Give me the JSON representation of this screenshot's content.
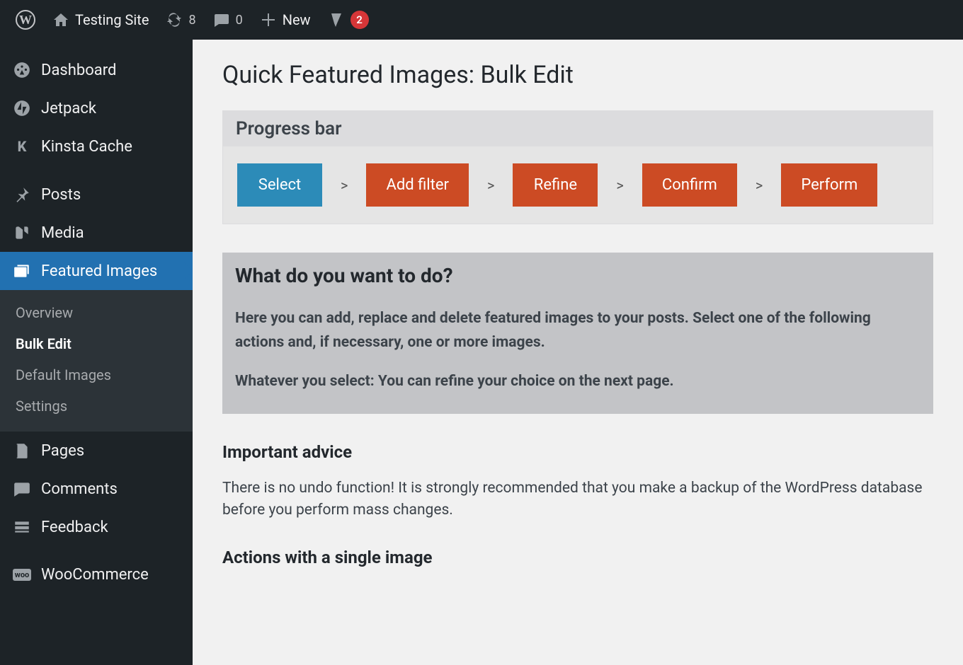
{
  "adminbar": {
    "site_name": "Testing Site",
    "updates_count": "8",
    "comments_count": "0",
    "new_label": "New",
    "yoast_count": "2"
  },
  "sidebar": {
    "items": [
      {
        "label": "Dashboard",
        "icon": "dashboard"
      },
      {
        "label": "Jetpack",
        "icon": "jetpack"
      },
      {
        "label": "Kinsta Cache",
        "icon": "kinsta"
      },
      {
        "label": "Posts",
        "icon": "posts"
      },
      {
        "label": "Media",
        "icon": "media"
      },
      {
        "label": "Featured Images",
        "icon": "featured",
        "active": true
      },
      {
        "label": "Pages",
        "icon": "pages"
      },
      {
        "label": "Comments",
        "icon": "comments"
      },
      {
        "label": "Feedback",
        "icon": "feedback"
      },
      {
        "label": "WooCommerce",
        "icon": "woo"
      }
    ],
    "submenu": [
      {
        "label": "Overview"
      },
      {
        "label": "Bulk Edit",
        "current": true
      },
      {
        "label": "Default Images"
      },
      {
        "label": "Settings"
      }
    ]
  },
  "main": {
    "title": "Quick Featured Images: Bulk Edit",
    "progress": {
      "header": "Progress bar",
      "steps": [
        "Select",
        "Add filter",
        "Refine",
        "Confirm",
        "Perform"
      ],
      "current_index": 0,
      "separator": ">"
    },
    "infobox": {
      "heading": "What do you want to do?",
      "p1": "Here you can add, replace and delete featured images to your posts. Select one of the following actions and, if necessary, one or more images.",
      "p2": "Whatever you select: You can refine your choice on the next page."
    },
    "advice": {
      "heading": "Important advice",
      "text": "There is no undo function! It is strongly recommended that you make a backup of the WordPress database before you perform mass changes."
    },
    "actions_single": {
      "heading": "Actions with a single image"
    }
  }
}
